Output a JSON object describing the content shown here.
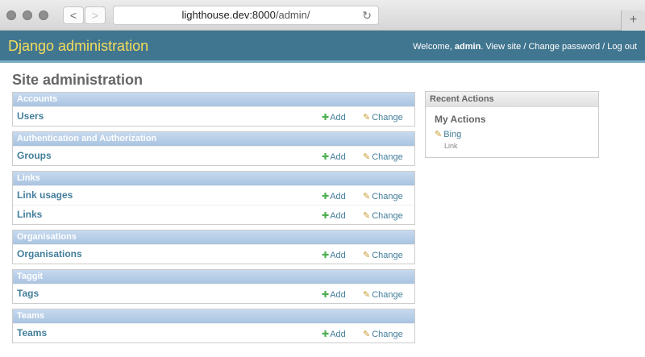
{
  "browser": {
    "url_host": "lighthouse.dev:8000",
    "url_path": "/admin/",
    "back_glyph": "<",
    "forward_glyph": ">",
    "reload_glyph": "↻",
    "newtab_glyph": "+"
  },
  "header": {
    "brand": "Django administration",
    "welcome": "Welcome,",
    "user": "admin",
    "view_site": "View site",
    "change_password": "Change password",
    "log_out": "Log out",
    "sep": "/"
  },
  "page": {
    "title": "Site administration"
  },
  "modules": [
    {
      "caption": "Accounts",
      "models": [
        {
          "name": "Users"
        }
      ]
    },
    {
      "caption": "Authentication and Authorization",
      "models": [
        {
          "name": "Groups"
        }
      ]
    },
    {
      "caption": "Links",
      "models": [
        {
          "name": "Link usages"
        },
        {
          "name": "Links"
        }
      ]
    },
    {
      "caption": "Organisations",
      "models": [
        {
          "name": "Organisations"
        }
      ]
    },
    {
      "caption": "Taggit",
      "models": [
        {
          "name": "Tags"
        }
      ]
    },
    {
      "caption": "Teams",
      "models": [
        {
          "name": "Teams"
        }
      ]
    }
  ],
  "actions": {
    "add": "Add",
    "change": "Change"
  },
  "recent_actions": {
    "caption": "Recent Actions",
    "heading": "My Actions",
    "items": [
      {
        "label": "Bing",
        "type": "Link"
      }
    ]
  },
  "colors": {
    "header_bg": "#417690",
    "brand": "#f5dd5d",
    "link": "#447e9b",
    "caption_bg": "#a9c3e0"
  },
  "icons": {
    "add": "plus-icon",
    "change": "pencil-icon"
  }
}
